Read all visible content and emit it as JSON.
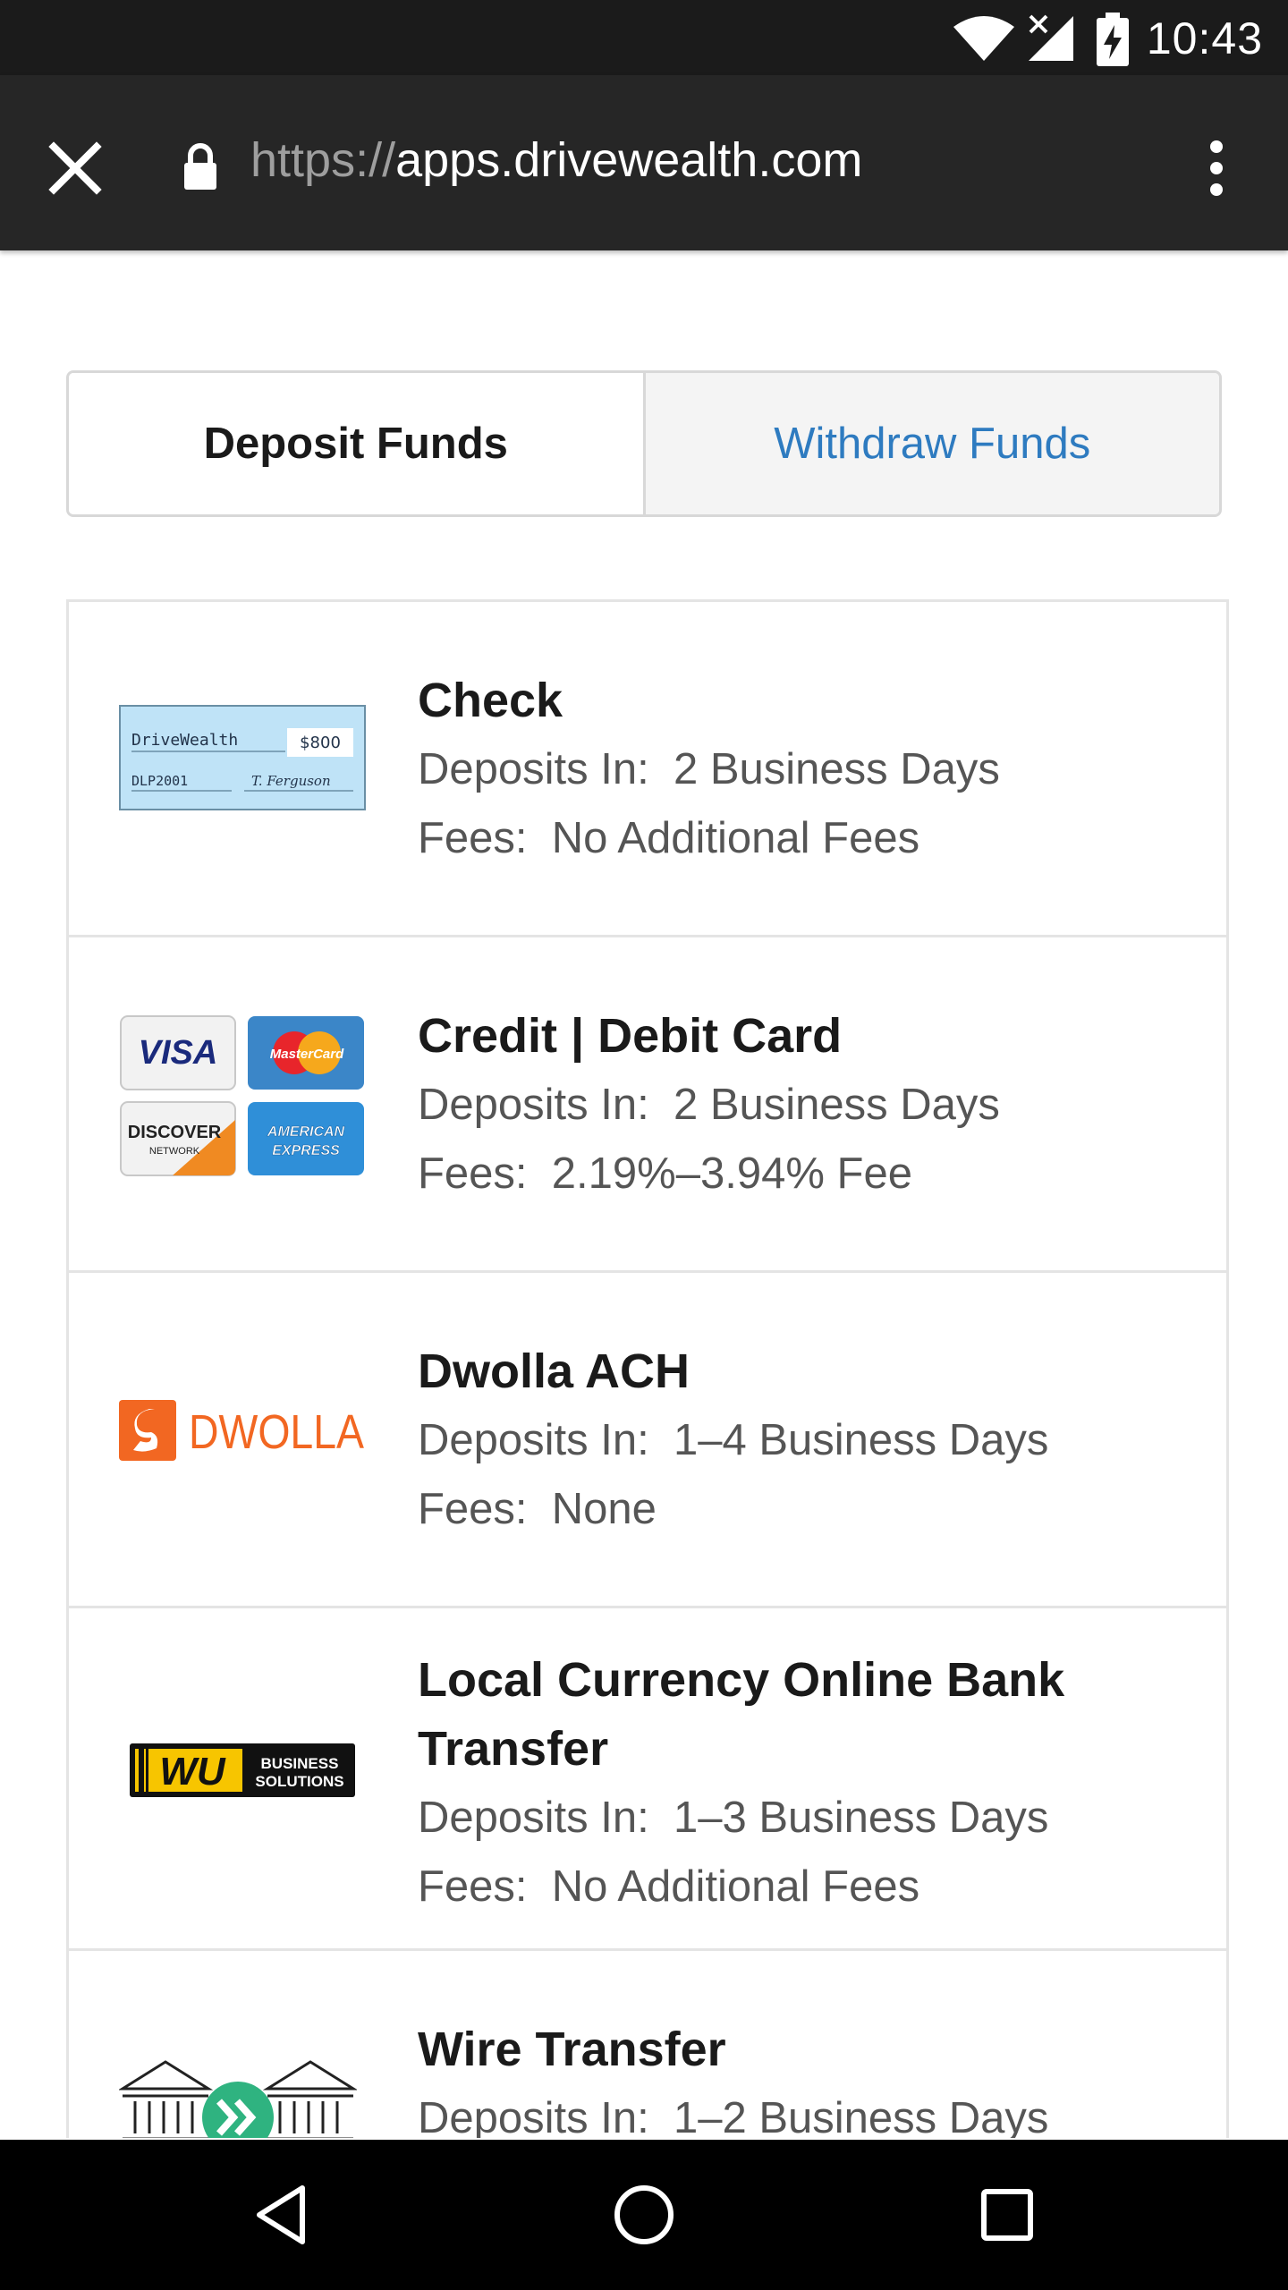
{
  "status_bar": {
    "time": "10:43",
    "icons": [
      "wifi-icon",
      "no-signal-icon",
      "battery-charging-icon"
    ]
  },
  "browser": {
    "url_scheme": "https://",
    "url_host": "apps.drivewealth.com",
    "icons": [
      "close-icon",
      "lock-icon",
      "overflow-menu-icon"
    ]
  },
  "tabs": {
    "deposit": "Deposit Funds",
    "withdraw": "Withdraw Funds",
    "accent_color": "#2e7bc0"
  },
  "check_image": {
    "payee_name": "DriveWealth",
    "amount": "$800",
    "memo": "DLP2001",
    "signature": "T. Ferguson"
  },
  "methods": [
    {
      "title": "Check",
      "deposits_label": "Deposits In:",
      "deposits_value": "2 Business Days",
      "fees_label": "Fees:",
      "fees_value": "No Additional Fees",
      "logo": "check-image"
    },
    {
      "title": "Credit | Debit Card",
      "deposits_label": "Deposits In:",
      "deposits_value": "2 Business Days",
      "fees_label": "Fees:",
      "fees_value": "2.19%–3.94% Fee",
      "logo": "card-logos"
    },
    {
      "title": "Dwolla ACH",
      "deposits_label": "Deposits In:",
      "deposits_value": "1–4 Business Days",
      "fees_label": "Fees:",
      "fees_value": "None",
      "logo": "dwolla-logo"
    },
    {
      "title": "Local Currency Online Bank Transfer",
      "deposits_label": "Deposits In:",
      "deposits_value": "1–3 Business Days",
      "fees_label": "Fees:",
      "fees_value": "No Additional Fees",
      "logo": "western-union-business-logo"
    },
    {
      "title": "Wire Transfer",
      "deposits_label": "Deposits In:",
      "deposits_value": "1–2 Business Days",
      "logo": "bank-transfer-icon"
    }
  ],
  "card_brands": {
    "visa": "VISA",
    "mastercard": "MasterCard",
    "discover": "DISCOVER",
    "discover_sub": "NETWORK",
    "amex_line1": "AMERICAN",
    "amex_line2": "EXPRESS"
  },
  "dwolla_brand": "DWOLLA",
  "wu_brand": {
    "mark": "WU",
    "line1": "BUSINESS",
    "line2": "SOLUTIONS"
  },
  "nav_bar": {
    "icons": [
      "back-icon",
      "home-icon",
      "recents-icon"
    ]
  }
}
